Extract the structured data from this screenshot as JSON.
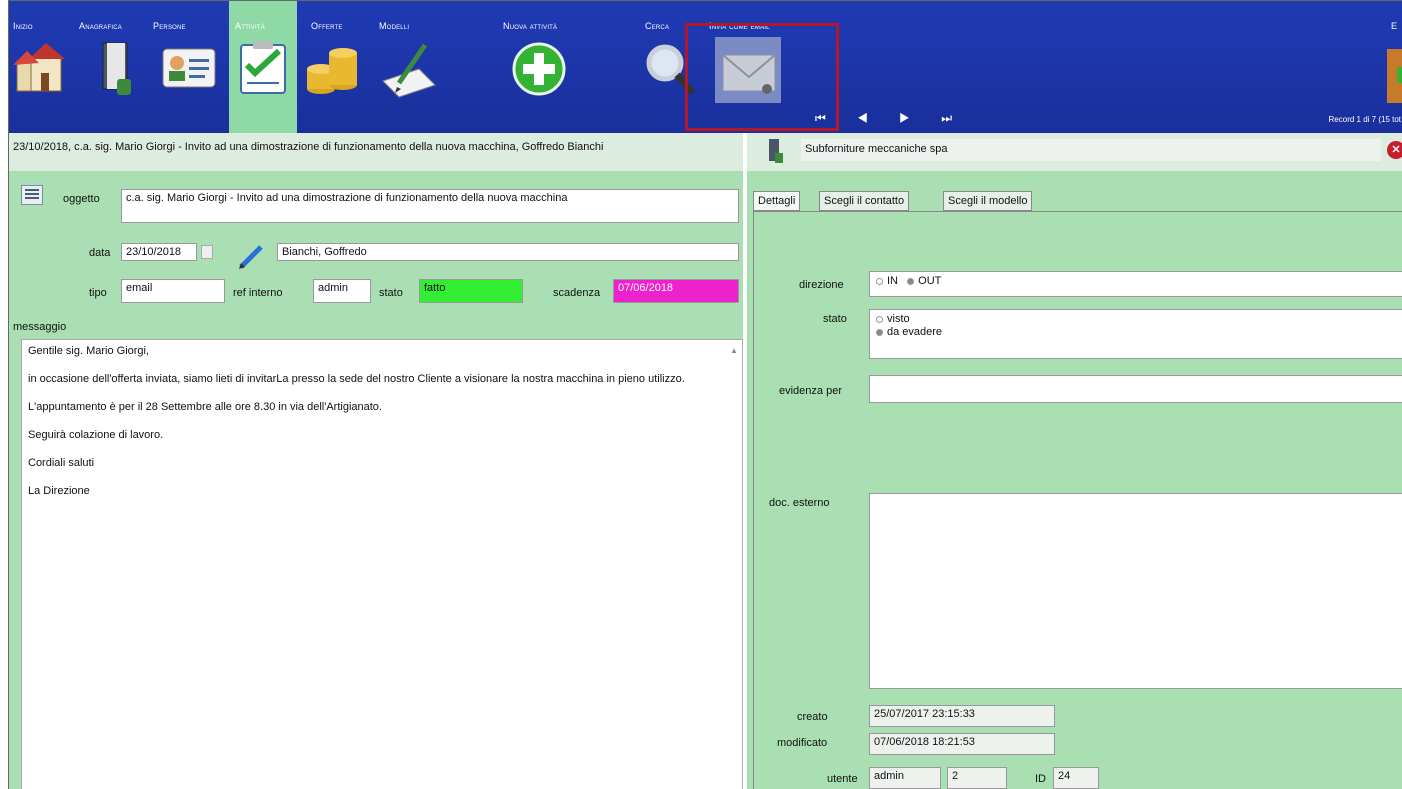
{
  "toolbar": {
    "items": [
      {
        "label": "Inizio",
        "icon": "home-icon"
      },
      {
        "label": "Anagrafica",
        "icon": "address-book-icon"
      },
      {
        "label": "Persone",
        "icon": "contact-card-icon"
      },
      {
        "label": "Attività",
        "icon": "checklist-icon"
      },
      {
        "label": "Offerte",
        "icon": "coins-icon"
      },
      {
        "label": "Modelli",
        "icon": "pen-paper-icon"
      },
      {
        "label": "Nuova attività",
        "icon": "plus-icon"
      },
      {
        "label": "Cerca",
        "icon": "search-icon"
      },
      {
        "label": "Invia come email",
        "icon": "envelope-icon"
      }
    ],
    "exit_label": "E",
    "nav_arrows": "⏮ ◀ ▶ ⏭",
    "record_count": "Record 1 di 7 (15 tot"
  },
  "left": {
    "header_title": "23/10/2018, c.a. sig. Mario Giorgi - Invito ad una dimostrazione di funzionamento della nuova macchina, Goffredo Bianchi",
    "oggetto_label": "oggetto",
    "oggetto_value": "c.a. sig. Mario Giorgi - Invito ad una dimostrazione di funzionamento della nuova macchina",
    "data_label": "data",
    "data_value": "23/10/2018",
    "assignee": "Bianchi, Goffredo",
    "tipo_label": "tipo",
    "tipo_value": "email",
    "ref_label": "ref interno",
    "ref_value": "admin",
    "stato_label": "stato",
    "stato_value": "fatto",
    "scadenza_label": "scadenza",
    "scadenza_value": "07/06/2018",
    "messaggio_label": "messaggio",
    "message": [
      "Gentile sig. Mario Giorgi,",
      "in occasione dell'offerta inviata, siamo lieti di invitarLa presso la sede del nostro Cliente a visionare la nostra macchina in pieno utilizzo.",
      "L'appuntamento è per il 28 Settembre alle ore 8.30 in via dell'Artigianato.",
      "Seguirà colazione di lavoro.",
      "Cordiali saluti",
      "La Direzione"
    ]
  },
  "right": {
    "company": "Subforniture meccaniche spa",
    "tabs": [
      "Dettagli",
      "Scegli il contatto",
      "Scegli il modello"
    ],
    "direzione_label": "direzione",
    "direzione_in": "IN",
    "direzione_out": "OUT",
    "stato_label": "stato",
    "stato_visto": "visto",
    "stato_evadere": "da evadere",
    "evidenza_label": "evidenza per",
    "evidenza_value": "",
    "doc_label": "doc. esterno",
    "creato_label": "creato",
    "creato_value": "25/07/2017 23:15:33",
    "modificato_label": "modificato",
    "modificato_value": "07/06/2018 18:21:53",
    "utente_label": "utente",
    "utente_value": "admin",
    "utente_num": "2",
    "id_label": "ID",
    "id_value": "24"
  },
  "colors": {
    "toolbar": "#1f3bb4",
    "panel_bg": "#a9dfb3",
    "stato_green": "#33ee33",
    "scadenza_magenta": "#ee22cc",
    "highlight_red": "#b3172a"
  }
}
